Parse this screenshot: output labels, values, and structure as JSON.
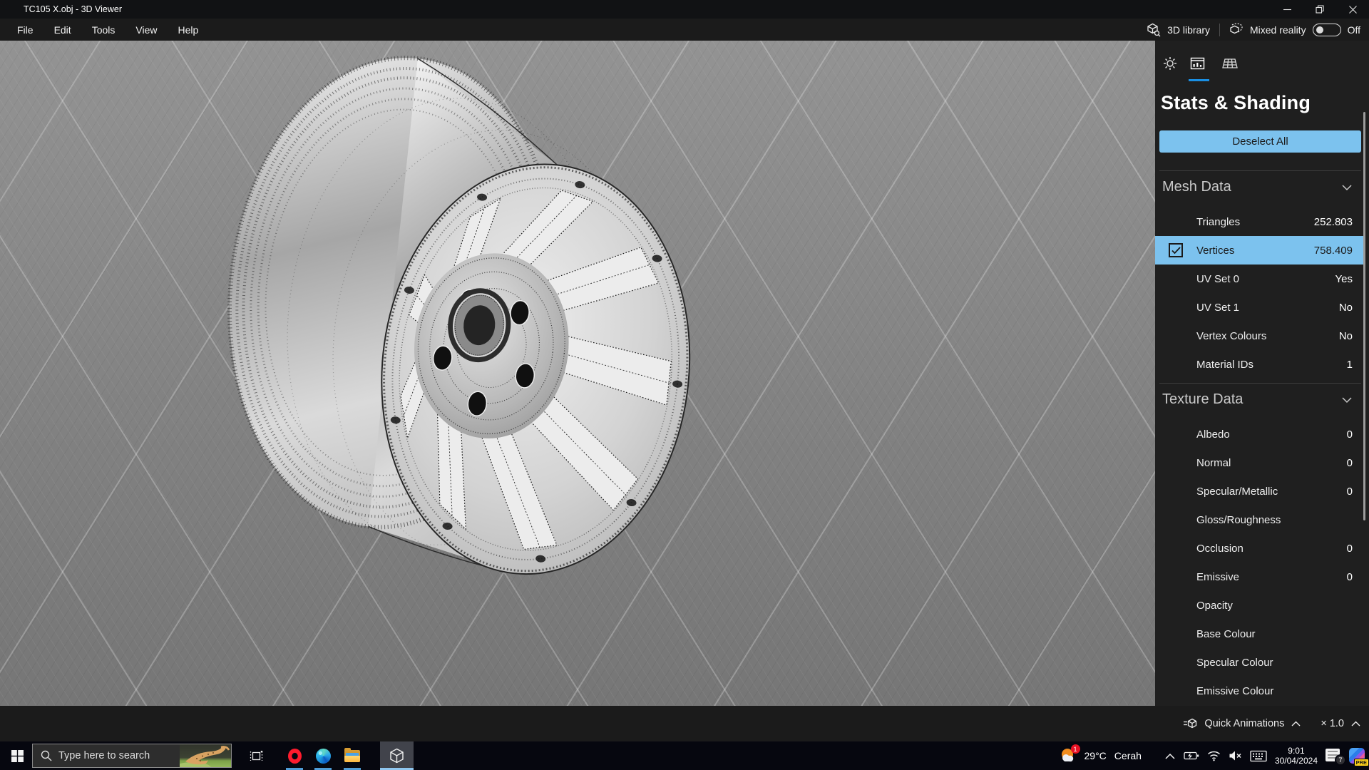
{
  "window": {
    "title": "TC105 X.obj - 3D Viewer"
  },
  "menubar": {
    "items": [
      "File",
      "Edit",
      "Tools",
      "View",
      "Help"
    ],
    "library_label": "3D library",
    "mixed_reality_label": "Mixed reality",
    "mixed_reality_state": "Off"
  },
  "panel": {
    "title": "Stats & Shading",
    "deselect_button": "Deselect All",
    "mesh": {
      "title": "Mesh Data",
      "rows": [
        {
          "label": "Triangles",
          "value": "252.803"
        },
        {
          "label": "Vertices",
          "value": "758.409",
          "selected": true
        },
        {
          "label": "UV Set 0",
          "value": "Yes"
        },
        {
          "label": "UV Set 1",
          "value": "No"
        },
        {
          "label": "Vertex Colours",
          "value": "No"
        },
        {
          "label": "Material IDs",
          "value": "1"
        }
      ]
    },
    "texture": {
      "title": "Texture Data",
      "rows": [
        {
          "label": "Albedo",
          "value": "0"
        },
        {
          "label": "Normal",
          "value": "0"
        },
        {
          "label": "Specular/Metallic",
          "value": "0"
        },
        {
          "label": "Gloss/Roughness",
          "value": ""
        },
        {
          "label": "Occlusion",
          "value": "0"
        },
        {
          "label": "Emissive",
          "value": "0"
        },
        {
          "label": "Opacity",
          "value": ""
        },
        {
          "label": "Base Colour",
          "value": ""
        },
        {
          "label": "Specular Colour",
          "value": ""
        },
        {
          "label": "Emissive Colour",
          "value": ""
        }
      ]
    }
  },
  "bottombar": {
    "quick_animations": "Quick Animations",
    "speed": "× 1.0"
  },
  "taskbar": {
    "search_placeholder": "Type here to search",
    "tray": {
      "temperature": "29°C",
      "condition": "Cerah",
      "time": "9:01",
      "date": "30/04/2024",
      "weather_badge": "1",
      "notifications_badge": "7",
      "pre_badge": "PRE"
    }
  },
  "colors": {
    "accent_blue": "#1a8fe3",
    "highlight_blue": "#7cc2ee"
  }
}
